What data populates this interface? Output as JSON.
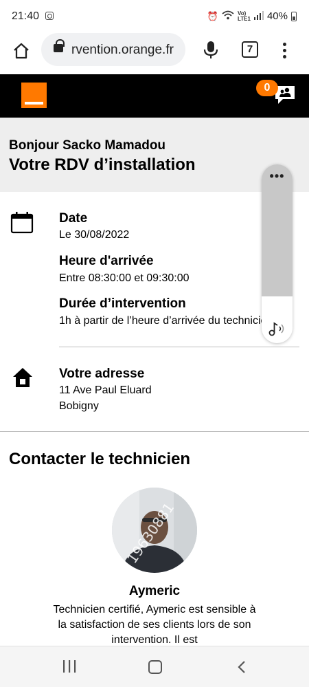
{
  "status_bar": {
    "time": "21:40",
    "battery": "40%"
  },
  "browser": {
    "url": "rvention.orange.fr",
    "tab_count": "7"
  },
  "header": {
    "notification_count": "0",
    "brand_color": "#ff7900"
  },
  "greeting": {
    "hello": "Bonjour Sacko Mamadou",
    "title": "Votre RDV d’installation"
  },
  "appointment": {
    "date_label": "Date",
    "date_value": "Le 30/08/2022",
    "arrival_label": "Heure d'arrivée",
    "arrival_value": "Entre 08:30:00 et 09:30:00",
    "duration_label": "Durée d’intervention",
    "duration_value": "1h à partir de l’heure d’arrivée du technicien"
  },
  "address": {
    "label": "Votre adresse",
    "line1": "11 Ave Paul Eluard",
    "line2": "Bobigny"
  },
  "contact": {
    "title": "Contacter le technicien",
    "photo_watermark": "19630881",
    "technician_name": "Aymeric",
    "technician_desc": "Technicien certifié, Aymeric est sensible à la satisfaction de ses clients lors de son intervention. Il est"
  },
  "audio_widget": {
    "more_label": "•••",
    "progress": 0.74
  },
  "icons": {
    "home": "home-icon",
    "lock": "lock-icon",
    "mic": "mic-icon",
    "menu": "more-vert-icon",
    "calendar": "calendar-icon",
    "house": "house-icon",
    "chat": "chat-people-icon",
    "note": "music-note-icon"
  }
}
